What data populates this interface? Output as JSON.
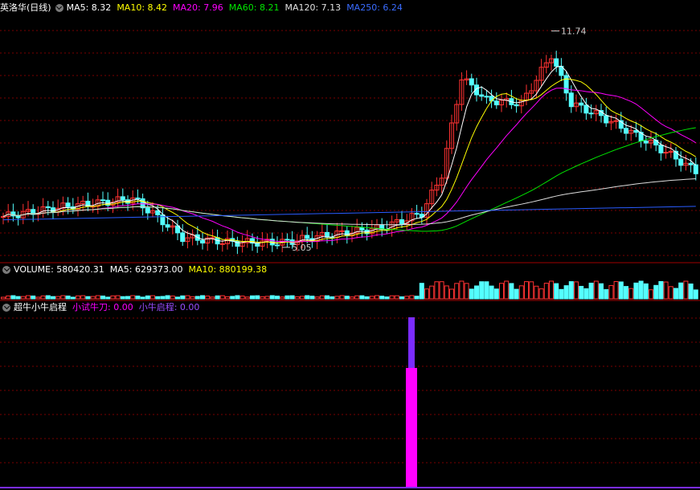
{
  "main_header": {
    "title": "英洛华(日线)",
    "ma5": "MA5: 8.32",
    "ma10": "MA10: 8.42",
    "ma20": "MA20: 7.96",
    "ma60": "MA60: 8.21",
    "ma120": "MA120: 7.13",
    "ma250": "MA250: 6.24"
  },
  "volume_header": {
    "volume": "VOLUME: 580420.31",
    "ma5": "MA5: 629373.00",
    "ma10": "MA10: 880199.38"
  },
  "indicator_header": {
    "name": "超牛小牛启程",
    "x1": "小试牛刀: 0.00",
    "x2": "小牛启程: 0.00"
  },
  "annotations": {
    "high": "11.74",
    "low": "5.05"
  },
  "colors": {
    "up": "#ff3232",
    "down": "#54ffff",
    "ma5": "#ffffff",
    "ma10": "#ffff00",
    "ma20": "#ff00ff",
    "ma60": "#00e600",
    "ma120": "#dddddd",
    "ma250": "#2a5cff",
    "magenta_bar": "#ff00ff",
    "purple_bar": "#7b2cff",
    "grid": "#7a0000"
  },
  "chart_data": [
    {
      "type": "candlestick",
      "name": "price",
      "ylim": [
        4.6,
        12.3
      ],
      "series": [
        {
          "name": "MA5",
          "value": 8.32
        },
        {
          "name": "MA10",
          "value": 8.42
        },
        {
          "name": "MA20",
          "value": 7.96
        },
        {
          "name": "MA60",
          "value": 8.21
        },
        {
          "name": "MA120",
          "value": 7.13
        },
        {
          "name": "MA250",
          "value": 6.24
        }
      ],
      "high_mark": 11.74,
      "low_mark": 5.05
    },
    {
      "type": "bar",
      "name": "VOLUME",
      "series": [
        {
          "name": "VOLUME",
          "value": 580420.31
        },
        {
          "name": "MA5",
          "value": 629373.0
        },
        {
          "name": "MA10",
          "value": 880199.38
        }
      ]
    },
    {
      "type": "bar",
      "name": "超牛小牛启程",
      "series": [
        {
          "name": "小试牛刀",
          "value": 0.0
        },
        {
          "name": "小牛启程",
          "value": 0.0
        }
      ]
    }
  ]
}
